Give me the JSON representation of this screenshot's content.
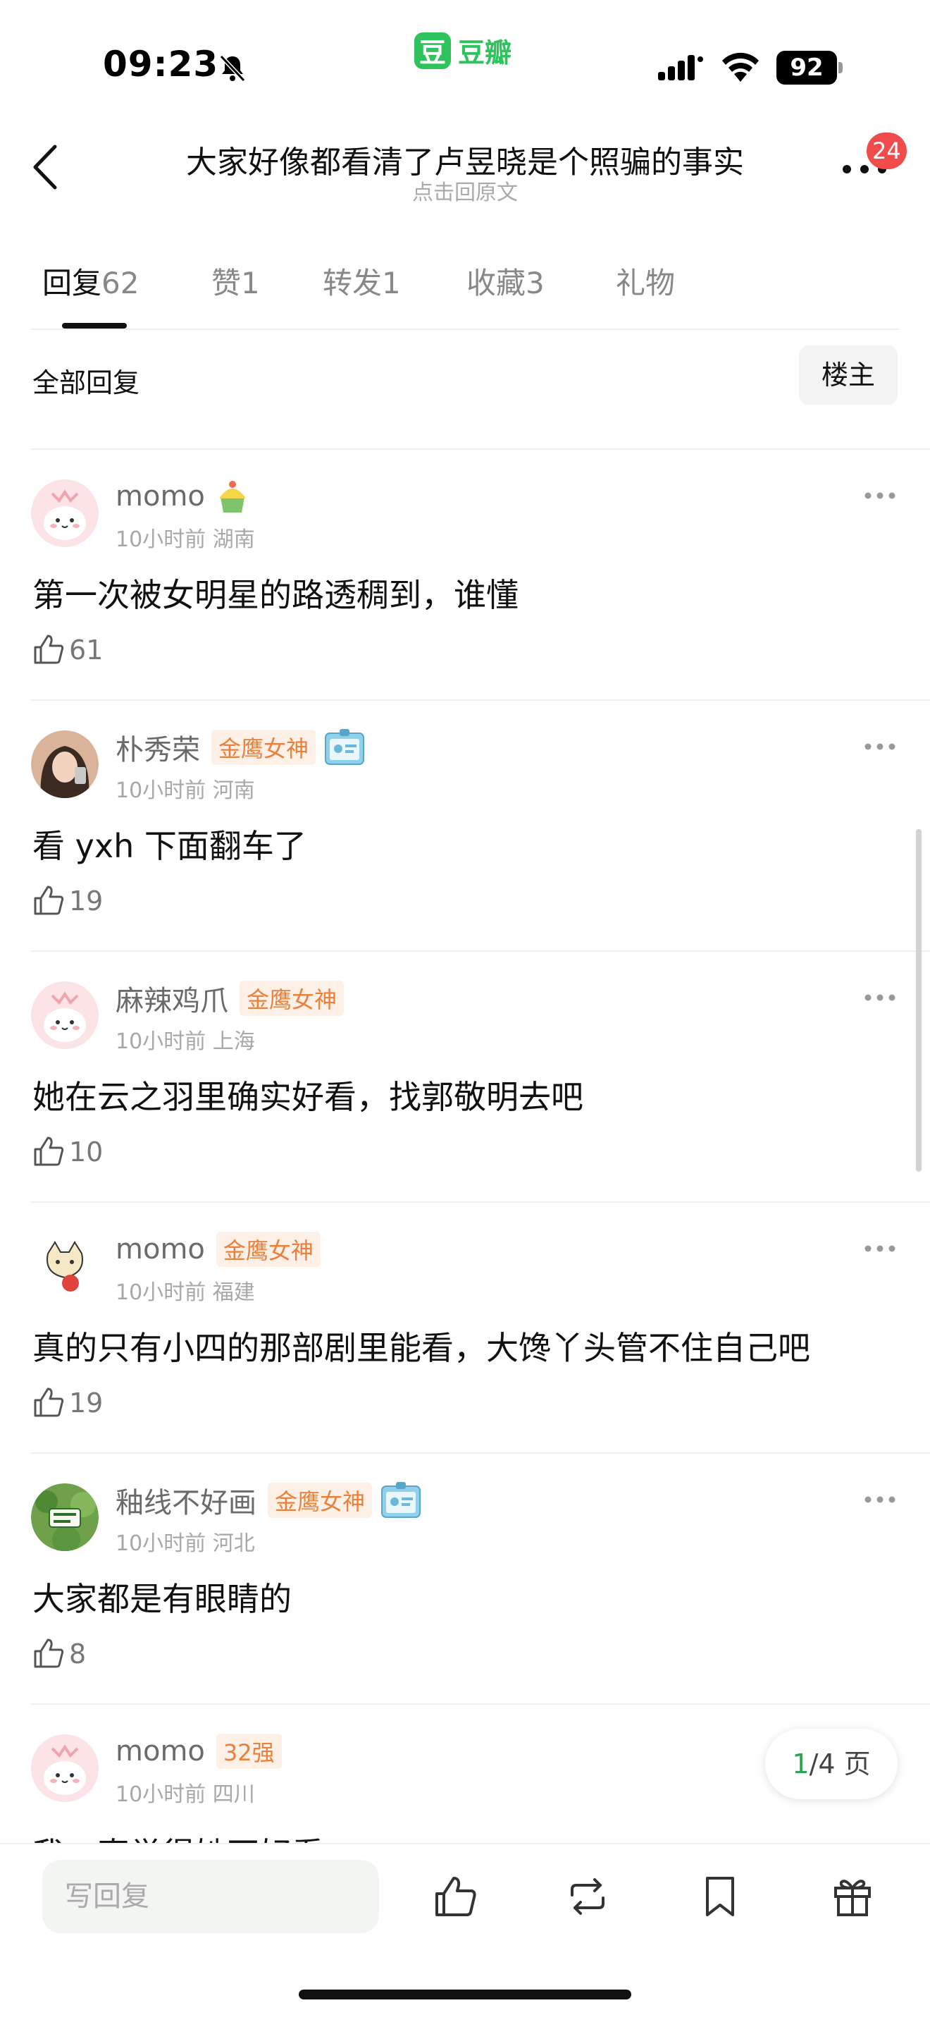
{
  "status_bar": {
    "time": "09:23",
    "app_logo": "豆",
    "app_name": "豆瓣",
    "battery": "92"
  },
  "header": {
    "title": "大家好像都看清了卢昱晓是个照骗的事实",
    "subtitle": "点击回原文",
    "notification_count": "24"
  },
  "tabs": [
    {
      "label": "回复",
      "count": "62"
    },
    {
      "label": "赞",
      "count": "1"
    },
    {
      "label": "转发",
      "count": "1"
    },
    {
      "label": "收藏",
      "count": "3"
    },
    {
      "label": "礼物",
      "count": ""
    }
  ],
  "filter": {
    "label": "全部回复",
    "op_button": "楼主"
  },
  "comments": [
    {
      "author": "momo",
      "rank": "",
      "meta": "10小时前 湖南",
      "text": "第一次被女明星的路透稠到，谁懂",
      "likes": "61",
      "badge": "cake-icon"
    },
    {
      "author": "朴秀荣",
      "rank": "金鹰女神",
      "meta": "10小时前 河南",
      "text": "看 yxh 下面翻车了",
      "likes": "19",
      "badge": "medal-icon"
    },
    {
      "author": "麻辣鸡爪",
      "rank": "金鹰女神",
      "meta": "10小时前 上海",
      "text": "她在云之羽里确实好看，找郭敬明去吧",
      "likes": "10",
      "badge": ""
    },
    {
      "author": "momo",
      "rank": "金鹰女神",
      "meta": "10小时前 福建",
      "text": "真的只有小四的那部剧里能看，大馋丫头管不住自己吧",
      "likes": "19",
      "badge": ""
    },
    {
      "author": "釉线不好画",
      "rank": "金鹰女神",
      "meta": "10小时前 河北",
      "text": "大家都是有眼睛的",
      "likes": "8",
      "badge": "medal-icon"
    },
    {
      "author": "momo",
      "rank": "32强",
      "meta": "10小时前 四川",
      "text": "我一直觉得她不好看",
      "likes": "",
      "badge": ""
    }
  ],
  "pager": {
    "current": "1",
    "total": "/4 页"
  },
  "bottom_bar": {
    "reply_placeholder": "写回复"
  },
  "colors": {
    "accent_green": "#2ec35c",
    "rank_orange": "#e8813c",
    "badge_red": "#f04c4c"
  }
}
